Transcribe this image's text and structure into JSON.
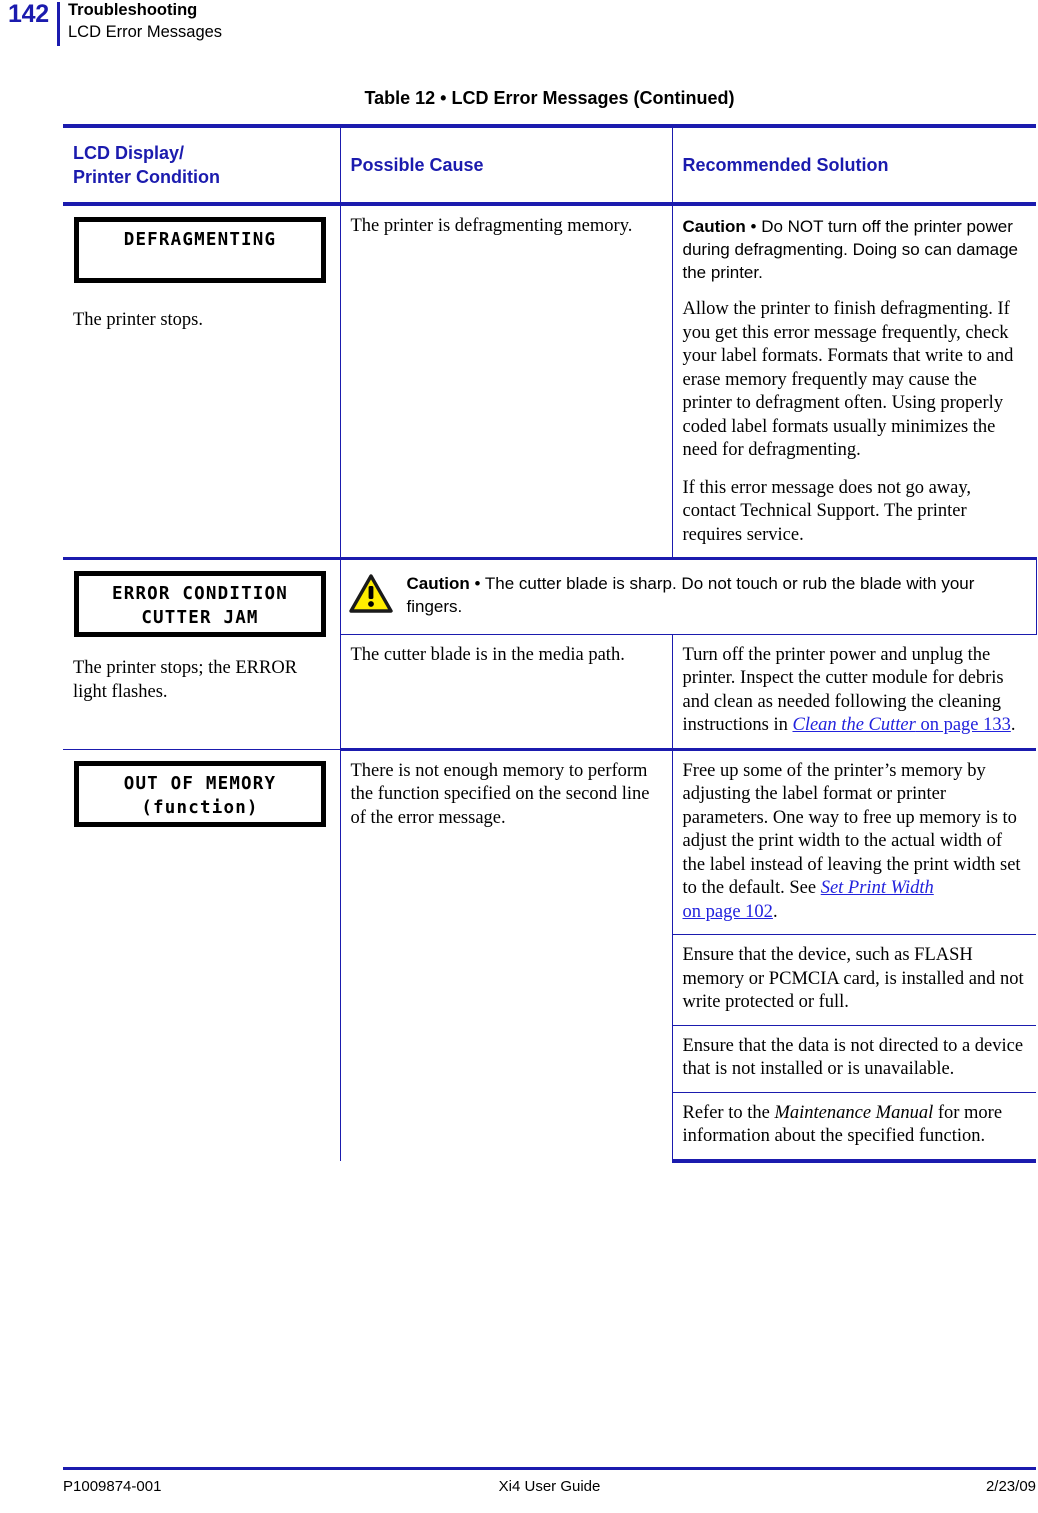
{
  "header": {
    "page_number": "142",
    "chapter": "Troubleshooting",
    "section": "LCD Error Messages"
  },
  "table": {
    "caption": "Table 12 • LCD Error Messages (Continued)",
    "columns": [
      "LCD Display/\nPrinter Condition",
      "Possible Cause",
      "Recommended Solution"
    ],
    "column_headers": {
      "lcd_display_line1": "LCD Display/",
      "lcd_display_line2": "Printer Condition",
      "possible_cause": "Possible Cause",
      "recommended_solution": "Recommended Solution"
    },
    "rows": [
      {
        "lcd_lines": [
          "DEFRAGMENTING"
        ],
        "condition": "The printer stops.",
        "cause": "The printer is defragmenting memory.",
        "solution_caution_label": "Caution",
        "solution_caution_bullet": "•",
        "solution_caution_text": "Do NOT turn off the printer power during defragmenting. Doing so can damage the printer.",
        "solution_paragraphs": [
          "Allow the printer to finish defragmenting. If you get this error message frequently, check your label formats. Formats that write to and erase memory frequently may cause the printer to defragment often. Using properly coded label formats usually minimizes the need for defragmenting.",
          "If this error message does not go away, contact Technical Support. The printer requires service."
        ]
      },
      {
        "lcd_lines": [
          "ERROR CONDITION",
          "CUTTER JAM"
        ],
        "condition": "The printer stops; the ERROR light flashes.",
        "banner_icon": "caution-triangle-icon",
        "banner_label": "Caution",
        "banner_bullet": "•",
        "banner_text": "The cutter blade is sharp. Do not touch or rub the blade with your fingers.",
        "cause": "The cutter blade is in the media path.",
        "solution_text_before_link": "Turn off the printer power and unplug the printer. Inspect the cutter module for debris and clean as needed following the cleaning instructions in ",
        "solution_link_italic": "Clean the Cutter",
        "solution_link_tail": " on page 133",
        "solution_text_after_link": "."
      },
      {
        "lcd_lines": [
          "OUT OF MEMORY",
          "(function)"
        ],
        "condition": "",
        "cause": "There is not enough memory to perform the function specified on the second line of the error message.",
        "solutions": [
          {
            "text_before_link": "Free up some of the printer’s memory by adjusting the label format or printer parameters. One way to free up memory is to adjust the print width to the actual width of the label instead of leaving the print width set to the default. See ",
            "link_italic": "Set Print Width",
            "link_tail": "on page 102",
            "text_after_link": "."
          },
          {
            "text": "Ensure that the device, such as FLASH memory or PCMCIA card, is installed and not write protected or full."
          },
          {
            "text": "Ensure that the data is not directed to a device that is not installed or is unavailable."
          },
          {
            "text_before_italic": "Refer to the ",
            "italic": "Maintenance Manual",
            "text_after_italic": " for more information about the specified function."
          }
        ]
      }
    ]
  },
  "footer": {
    "left": "P1009874-001",
    "center": "Xi4 User Guide",
    "right": "2/23/09"
  },
  "colors": {
    "accent_navy": "#1b1bae",
    "link_blue": "#2222dd",
    "caution_yellow": "#ffed00"
  }
}
